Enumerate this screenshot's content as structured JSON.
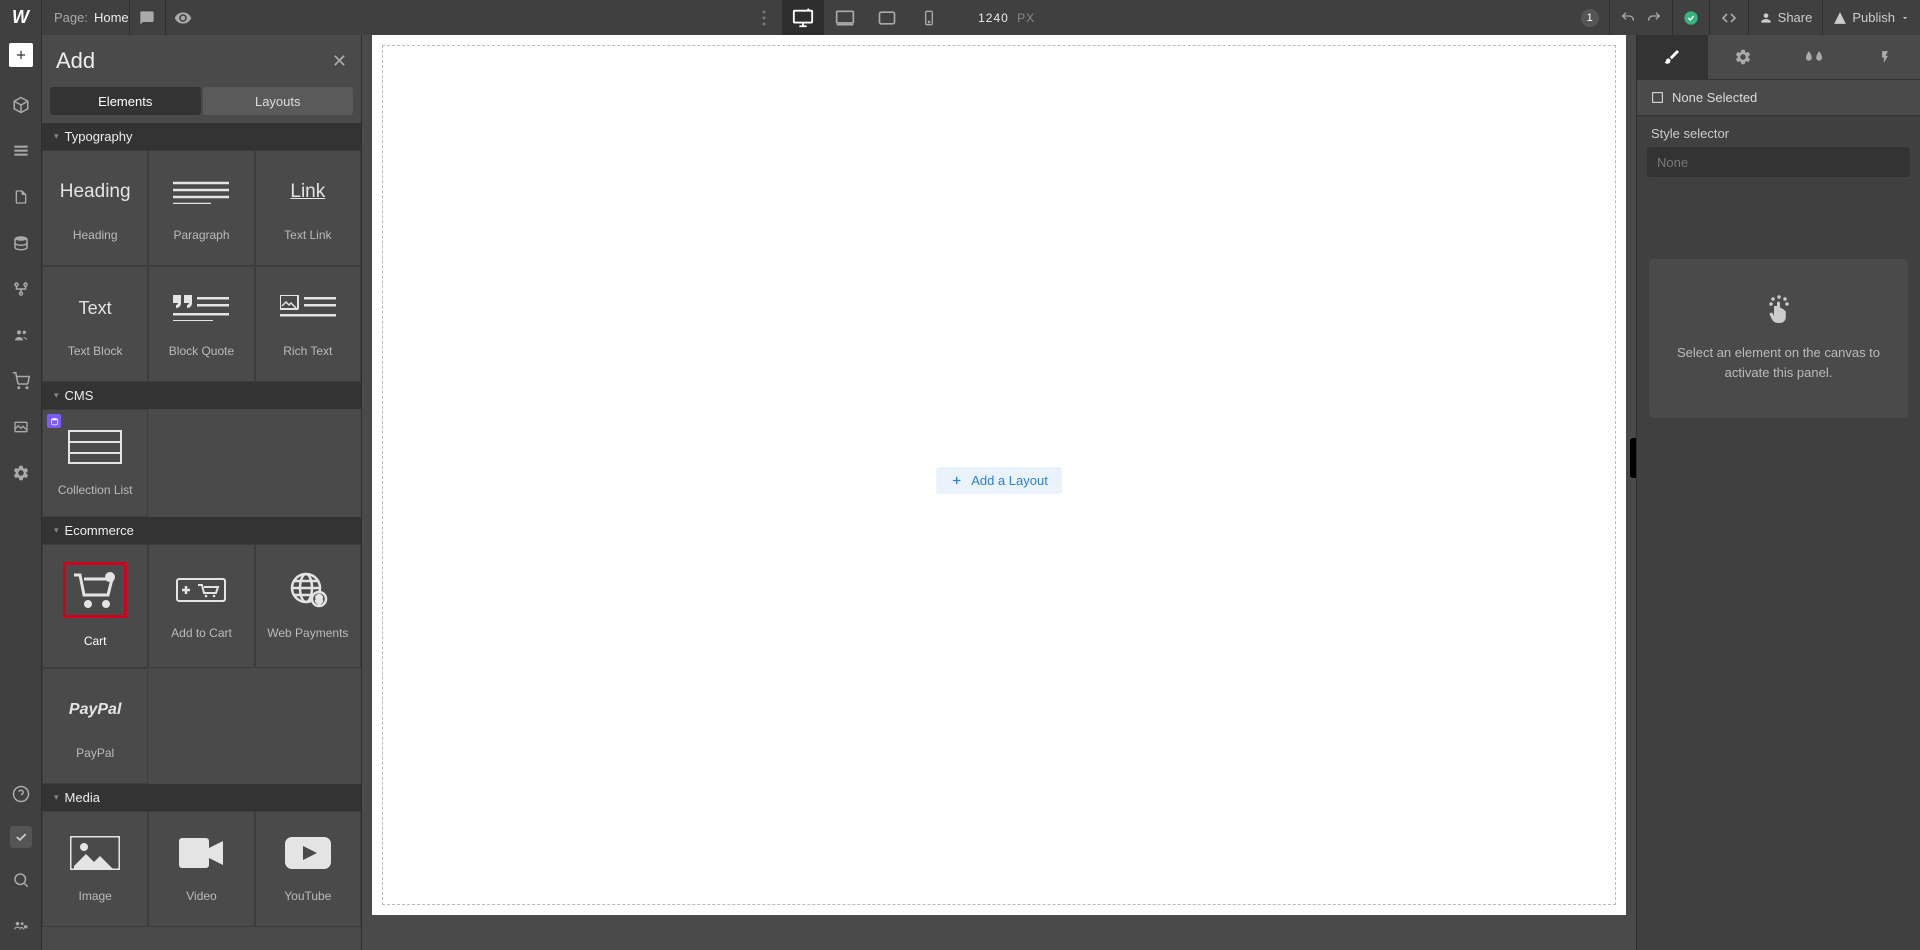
{
  "topbar": {
    "page_label": "Page:",
    "page_name": "Home",
    "canvas_width": "1240",
    "canvas_unit": "PX",
    "changes_badge": "1",
    "share": "Share",
    "publish": "Publish"
  },
  "add_panel": {
    "title": "Add",
    "tabs": {
      "elements": "Elements",
      "layouts": "Layouts"
    },
    "categories": {
      "typography": {
        "label": "Typography",
        "items": [
          "Heading",
          "Paragraph",
          "Text Link",
          "Text Block",
          "Block Quote",
          "Rich Text"
        ]
      },
      "cms": {
        "label": "CMS",
        "items": [
          "Collection List"
        ]
      },
      "ecommerce": {
        "label": "Ecommerce",
        "items": [
          "Cart",
          "Add to Cart",
          "Web Payments",
          "PayPal"
        ]
      },
      "media": {
        "label": "Media",
        "items": [
          "Image",
          "Video",
          "YouTube"
        ]
      }
    }
  },
  "canvas": {
    "add_layout": "Add a Layout"
  },
  "right_panel": {
    "none_selected": "None Selected",
    "style_selector_label": "Style selector",
    "style_selector_placeholder": "None",
    "hint": "Select an element on the canvas to activate this panel."
  }
}
